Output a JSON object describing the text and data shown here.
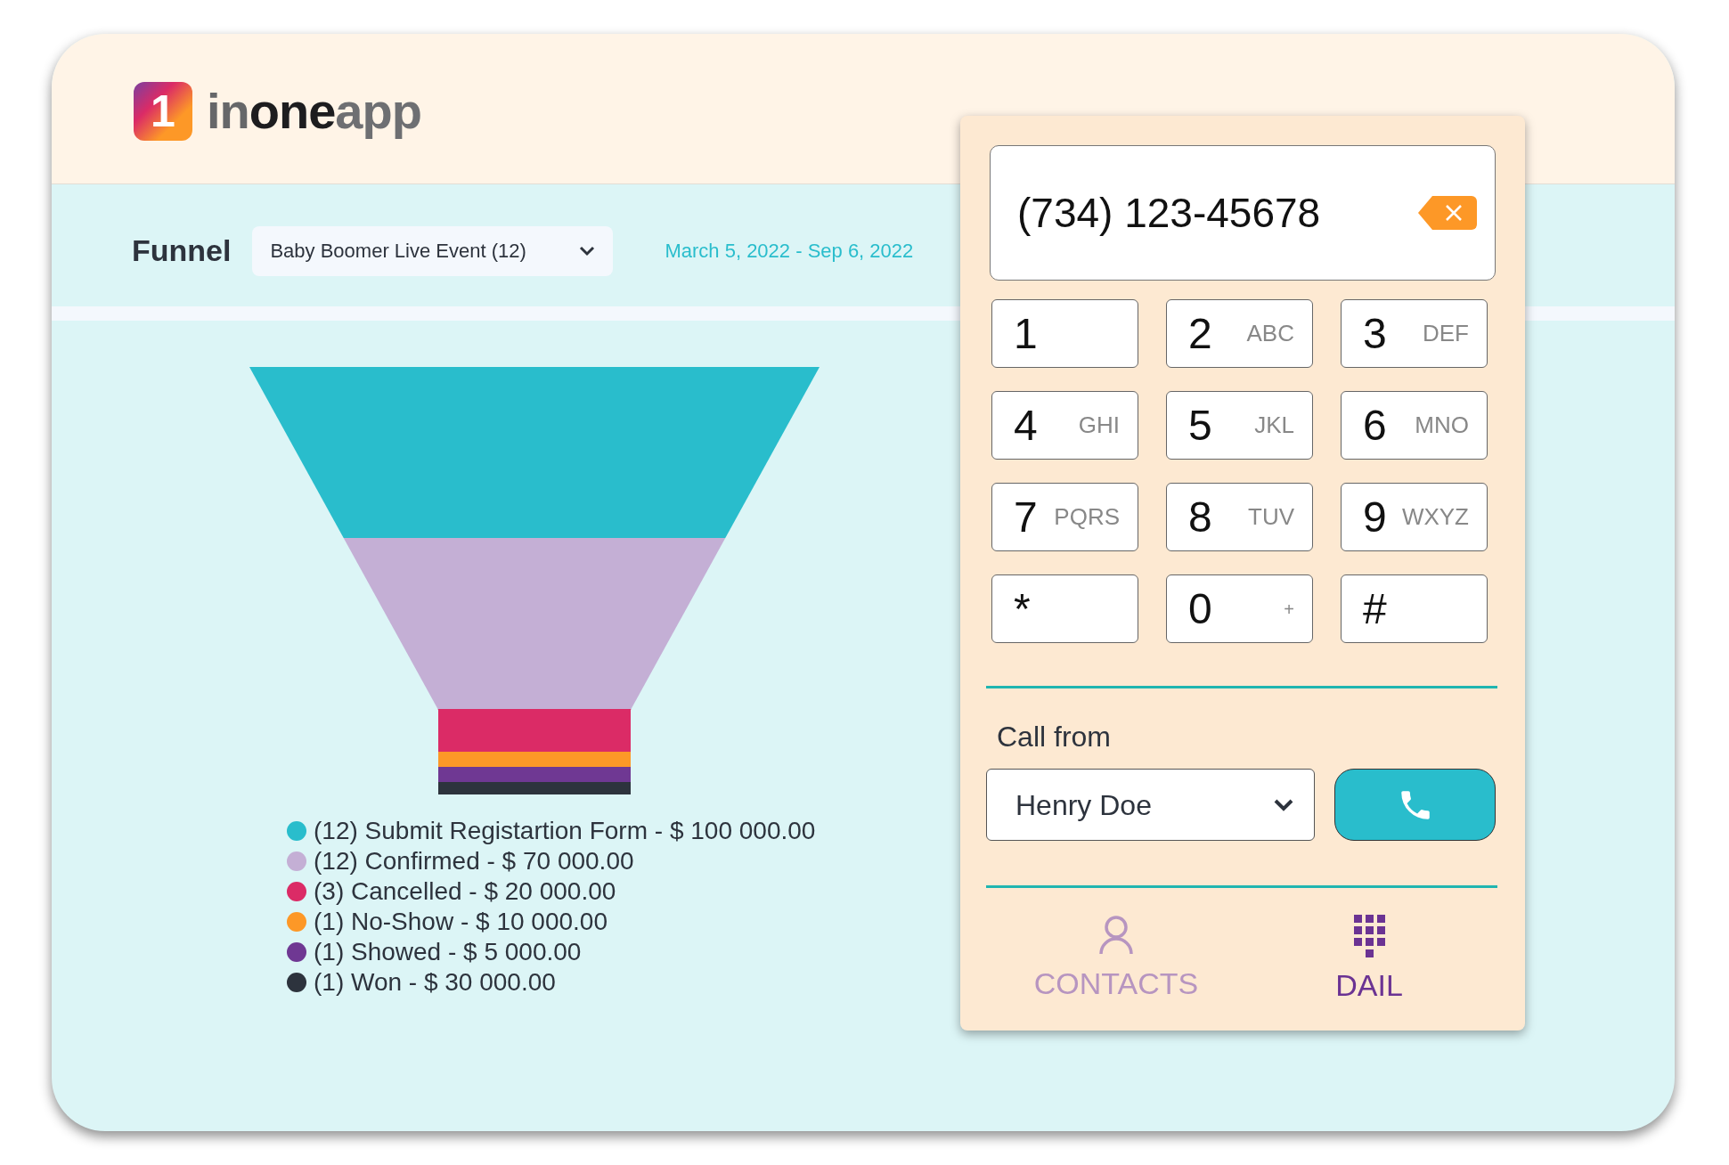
{
  "logo": {
    "mark": "1",
    "name_parts": [
      "in",
      "one",
      "app"
    ]
  },
  "filter": {
    "title": "Funnel",
    "funnel_select": "Baby Boomer Live Event (12)",
    "date_range": "March 5, 2022 - Sep 6, 2022"
  },
  "funnel": {
    "stages": [
      {
        "label": "(12) Submit Registartion Form - $ 100 000.00",
        "color": "#29bdcc"
      },
      {
        "label": "(12) Confirmed - $ 70 000.00",
        "color": "#c4afd5"
      },
      {
        "label": "(3) Cancelled - $ 20 000.00",
        "color": "#db2b66"
      },
      {
        "label": "(1) No-Show - $ 10 000.00",
        "color": "#fd9827"
      },
      {
        "label": "(1) Showed - $ 5 000.00",
        "color": "#6f3893"
      },
      {
        "label": "(1) Won - $ 30 000.00",
        "color": "#2d333d"
      }
    ]
  },
  "dialer": {
    "number": "(734) 123-45678",
    "keys": [
      {
        "digit": "1"
      },
      {
        "digit": "2",
        "letters": "ABC"
      },
      {
        "digit": "3",
        "letters": "DEF"
      },
      {
        "digit": "4",
        "letters": "GHI"
      },
      {
        "digit": "5",
        "letters": "JKL"
      },
      {
        "digit": "6",
        "letters": "MNO"
      },
      {
        "digit": "7",
        "letters": "PQRS"
      },
      {
        "digit": "8",
        "letters": "TUV"
      },
      {
        "digit": "9",
        "letters": "WXYZ"
      },
      {
        "digit": "*"
      },
      {
        "digit": "0",
        "letters": "+"
      },
      {
        "digit": "#"
      }
    ],
    "call_from_label": "Call from",
    "call_from": "Henry Doe",
    "tabs": [
      {
        "label": "CONTACTS",
        "kind": "contacts",
        "selected": false
      },
      {
        "label": "DAIL",
        "kind": "dial",
        "selected": true
      }
    ]
  }
}
